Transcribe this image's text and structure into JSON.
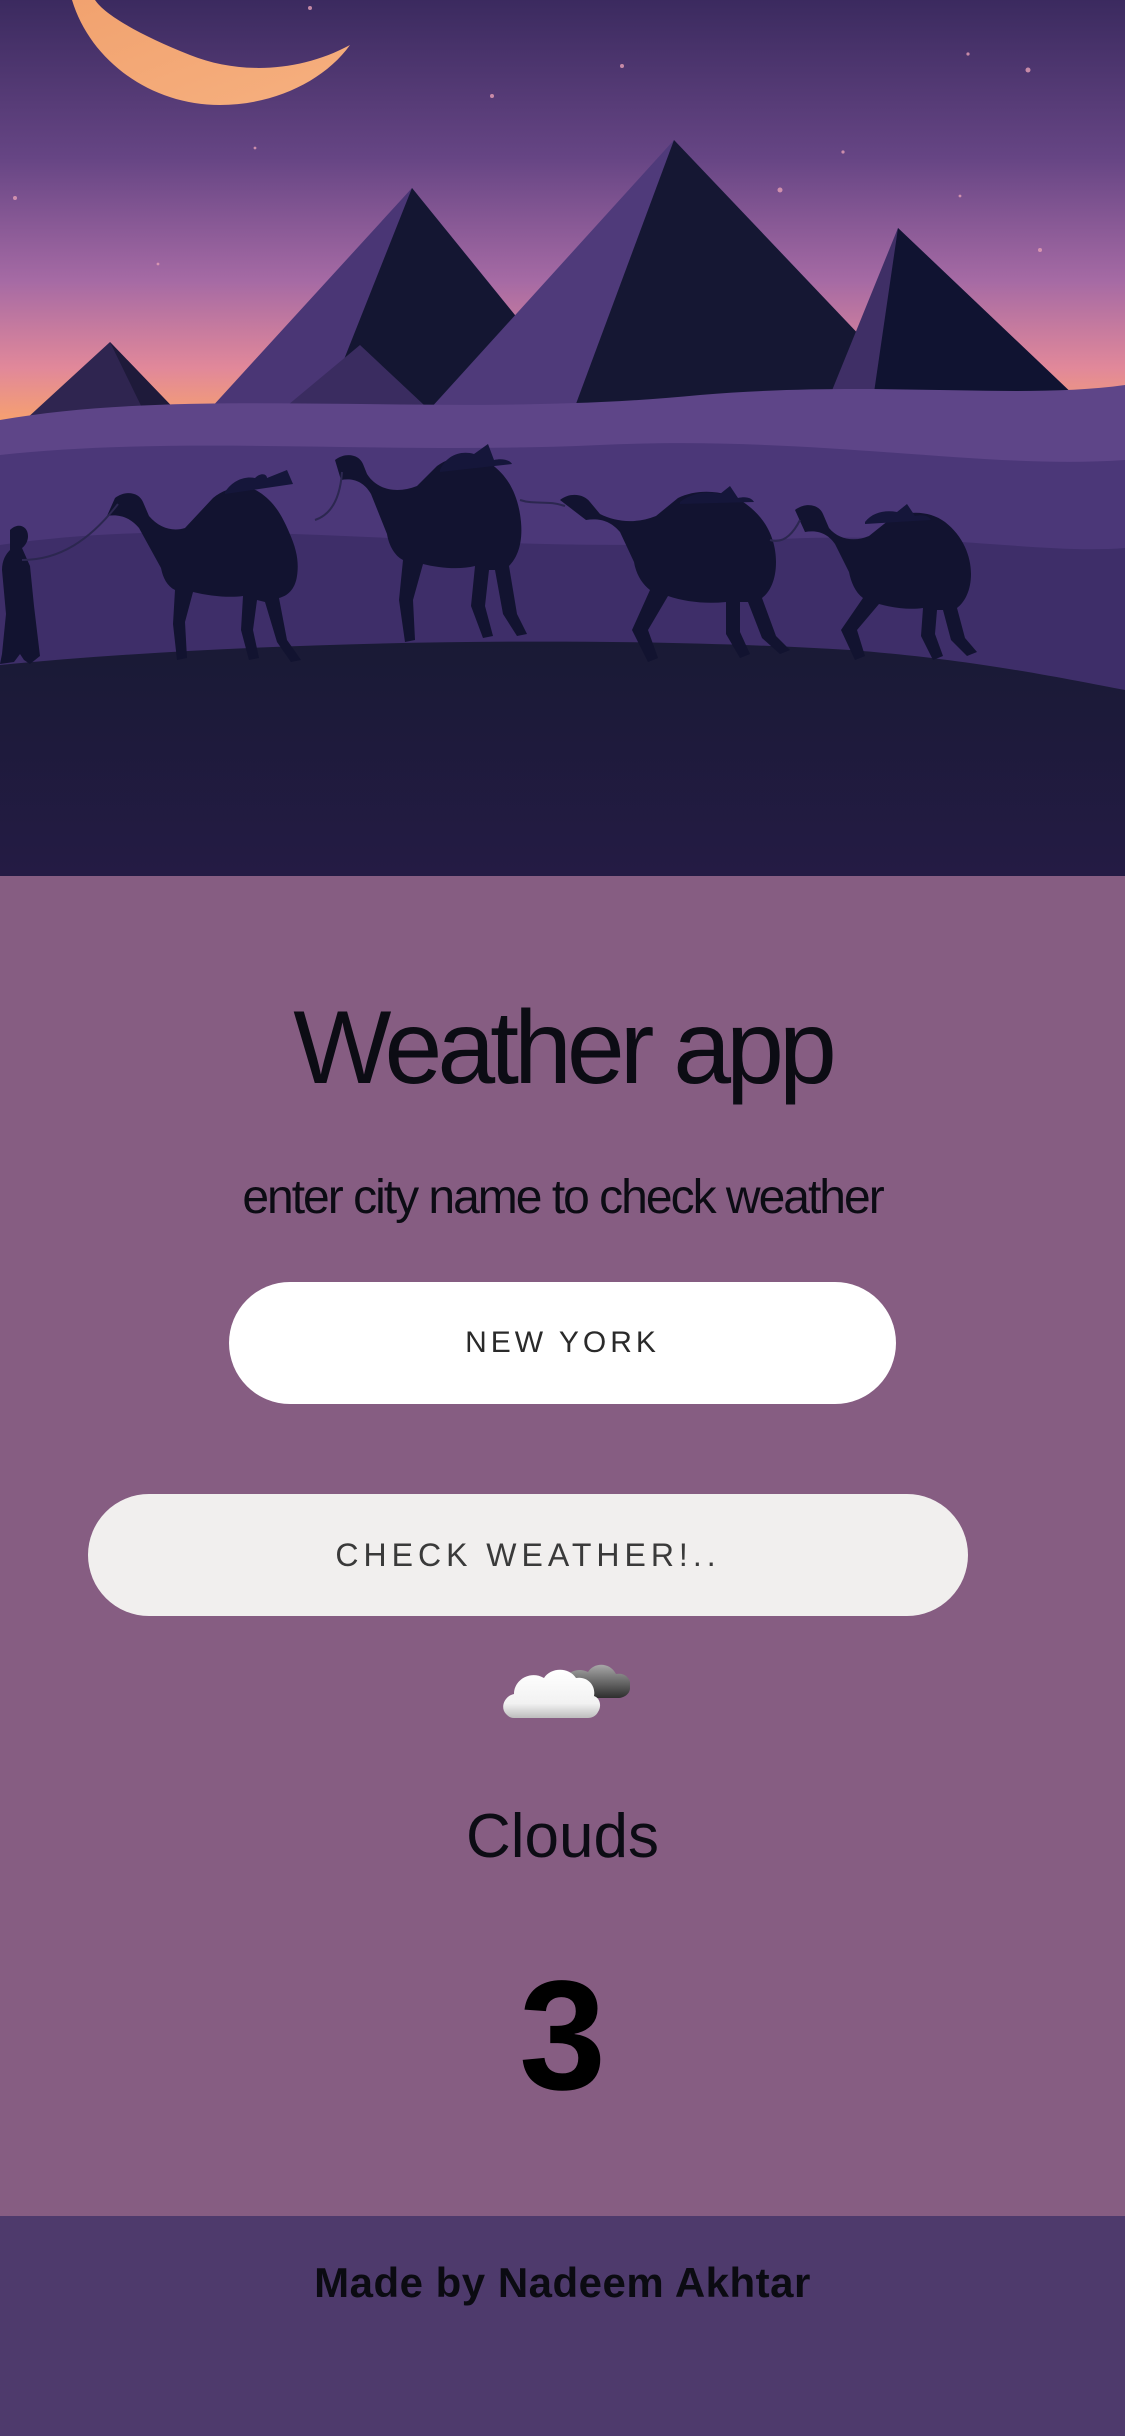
{
  "app": {
    "title": "Weather app",
    "subtitle": "enter city name to check weather"
  },
  "search": {
    "value": "NEW YORK",
    "placeholder": ""
  },
  "actions": {
    "check_label": "CHECK WEATHER!.."
  },
  "result": {
    "icon": "clouds-icon",
    "condition": "Clouds",
    "temperature": "3"
  },
  "footer": {
    "credit": "Made by Nadeem Akhtar"
  },
  "colors": {
    "main_bg": "#865d82",
    "footer_bg": "#4e3a6c",
    "input_bg": "#ffffff",
    "button_bg": "#f1efee",
    "sky_top": "#3f2d64",
    "sky_mid": "#a36aa3",
    "sky_bottom": "#f1a073",
    "moon": "#f6a36f"
  }
}
